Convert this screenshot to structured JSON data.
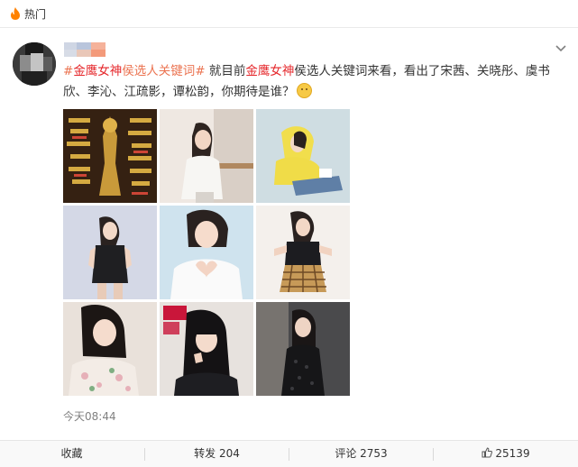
{
  "header": {
    "title": "热门",
    "icon": "fire-icon"
  },
  "post": {
    "hashtag": "#金鹰女神侯选人关键词#",
    "text": [
      {
        "t": "#",
        "c": "tag"
      },
      {
        "t": "金鹰女神",
        "c": "hl"
      },
      {
        "t": "侯选人关键词#",
        "c": "tag"
      },
      {
        "t": " 就目前",
        "c": ""
      },
      {
        "t": "金鹰女神",
        "c": "hl"
      },
      {
        "t": "侯选人关键词来看，看出了宋茜、关晓彤、虞书欣、李沁、江疏影，谭松韵，你期待是谁？",
        "c": ""
      }
    ],
    "emoji": "smile-emoji",
    "timestamp": "今天08:44"
  },
  "images": [
    {
      "name": "photo-keyword-collage"
    },
    {
      "name": "photo-1"
    },
    {
      "name": "photo-2"
    },
    {
      "name": "photo-3"
    },
    {
      "name": "photo-4"
    },
    {
      "name": "photo-5"
    },
    {
      "name": "photo-6"
    },
    {
      "name": "photo-7"
    },
    {
      "name": "photo-8"
    }
  ],
  "actions": {
    "favorite": "收藏",
    "repost": "转发 204",
    "comment": "评论 2753",
    "like_count": "25139"
  },
  "colors": {
    "hashtag": "#eb7350",
    "highlight": "#e5262a",
    "timestamp": "#808080"
  }
}
